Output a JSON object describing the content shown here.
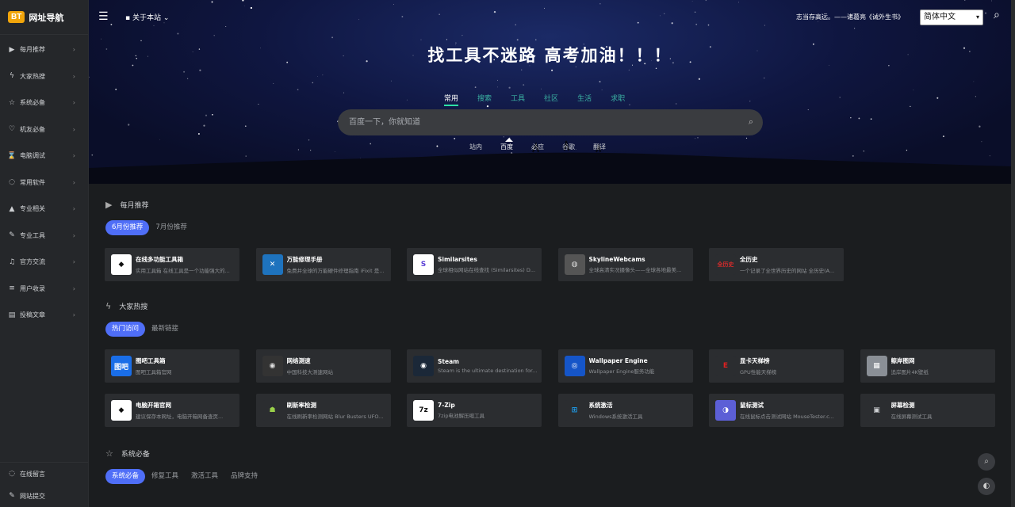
{
  "brand": {
    "logo": "BT",
    "name": "网址导航"
  },
  "sidebar": {
    "items": [
      {
        "icon": "video-icon",
        "glyph": "▶",
        "label": "每月推荐"
      },
      {
        "icon": "lightning-icon",
        "glyph": "ϟ",
        "label": "大家热搜"
      },
      {
        "icon": "star-icon",
        "glyph": "☆",
        "label": "系统必备"
      },
      {
        "icon": "thumb-icon",
        "glyph": "♡",
        "label": "机友必备"
      },
      {
        "icon": "hourglass-icon",
        "glyph": "⌛",
        "label": "电脑调试"
      },
      {
        "icon": "chat-icon",
        "glyph": "◌",
        "label": "常用软件"
      },
      {
        "icon": "graduation-icon",
        "glyph": "▲",
        "label": "专业相关"
      },
      {
        "icon": "wrench-icon",
        "glyph": "✎",
        "label": "专业工具"
      },
      {
        "icon": "bell-icon",
        "glyph": "♫",
        "label": "官方交流"
      },
      {
        "icon": "list-icon",
        "glyph": "≡",
        "label": "用户收录"
      },
      {
        "icon": "article-icon",
        "glyph": "▤",
        "label": "投稿文章"
      }
    ],
    "bottom": [
      {
        "icon": "message-icon",
        "glyph": "◌",
        "label": "在线留言"
      },
      {
        "icon": "pen-icon",
        "glyph": "✎",
        "label": "网站提交"
      }
    ]
  },
  "topbar": {
    "about": "关于本站",
    "quote": "志当存高远。——诸葛亮《诫外生书》",
    "language": "简体中文"
  },
  "hero": {
    "title": "找工具不迷路 高考加油！！！",
    "tabs": [
      "常用",
      "搜索",
      "工具",
      "社区",
      "生活",
      "求职"
    ],
    "search_placeholder": "百度一下，你就知道",
    "engines": [
      "站内",
      "百度",
      "必应",
      "谷歌",
      "翻译"
    ]
  },
  "sections": [
    {
      "title": "每月推荐",
      "icon": "video-icon",
      "glyph": "▶",
      "tabs": [
        "6月份推荐",
        "7月份推荐"
      ],
      "cards": [
        {
          "name": "在线多功能工具箱",
          "desc": "实用工具箱 在线工具是一个功能强大的...",
          "logo_text": "◆",
          "logo_bg": "#ffffff",
          "logo_fg": "#111111"
        },
        {
          "name": "万能修理手册",
          "desc": "免费并全球的万能硬件修理指南 iFixit 是...",
          "logo_text": "✕",
          "logo_bg": "#1e73be",
          "logo_fg": "#ffffff"
        },
        {
          "name": "Similarsites",
          "desc": "全球相似网站在线查找 (Similarsites) D...",
          "logo_text": "S",
          "logo_bg": "#ffffff",
          "logo_fg": "#5a3fd6"
        },
        {
          "name": "SkylineWebcams",
          "desc": "全球高清实况摄像头——全球各地最美...",
          "logo_text": "◍",
          "logo_bg": "#555555",
          "logo_fg": "#dddddd"
        },
        {
          "name": "全历史",
          "desc": "一个记录了全世界历史的网站 全历史(A...",
          "logo_text": "全历史",
          "logo_bg": "#2b2d30",
          "logo_fg": "#d62b2b"
        }
      ]
    },
    {
      "title": "大家热搜",
      "icon": "lightning-icon",
      "glyph": "ϟ",
      "tabs": [
        "热门访问",
        "最新链接"
      ],
      "cards": [
        {
          "name": "图吧工具箱",
          "desc": "图吧工具箱官网",
          "logo_text": "图吧",
          "logo_bg": "#1a6ee8",
          "logo_fg": "#ffffff"
        },
        {
          "name": "网络测速",
          "desc": "中国科技大测速网站",
          "logo_text": "◉",
          "logo_bg": "#333333",
          "logo_fg": "#e0e0e0"
        },
        {
          "name": "Steam",
          "desc": "Steam is the ultimate destination for...",
          "logo_text": "◉",
          "logo_bg": "#1b2838",
          "logo_fg": "#ffffff"
        },
        {
          "name": "Wallpaper Engine",
          "desc": "Wallpaper Engine服务功能",
          "logo_text": "◎",
          "logo_bg": "#1555c8",
          "logo_fg": "#ffffff"
        },
        {
          "name": "显卡天梯榜",
          "desc": "GPU性能天梯榜",
          "logo_text": "E",
          "logo_bg": "#2b2d30",
          "logo_fg": "#e02020"
        },
        {
          "name": "鲸岸图网",
          "desc": "追岸图片4K壁纸",
          "logo_text": "▦",
          "logo_bg": "#8a8f96",
          "logo_fg": "#ffffff"
        },
        {
          "name": "电脑开箱官网",
          "desc": "建议保存本网址，电脑开箱网备查页...",
          "logo_text": "◆",
          "logo_bg": "#ffffff",
          "logo_fg": "#111111"
        },
        {
          "name": "刷新率检测",
          "desc": "在线刷新率检测网站 Blur Busters UFO...",
          "logo_text": "☗",
          "logo_bg": "#2b2d30",
          "logo_fg": "#9ad14a"
        },
        {
          "name": "7-Zip",
          "desc": "7zip电池解压缩工具",
          "logo_text": "7z",
          "logo_bg": "#ffffff",
          "logo_fg": "#111111"
        },
        {
          "name": "系统激活",
          "desc": "Windows系统激活工具",
          "logo_text": "⊞",
          "logo_bg": "#2b2d30",
          "logo_fg": "#1da1f2"
        },
        {
          "name": "鼠标测试",
          "desc": "在线鼠标点击测试网站 MouseTester.c...",
          "logo_text": "◑",
          "logo_bg": "#5c5fd6",
          "logo_fg": "#ffffff"
        },
        {
          "name": "屏幕检测",
          "desc": "在线屏幕测试工具",
          "logo_text": "▣",
          "logo_bg": "#2b2d30",
          "logo_fg": "#cfd1d4"
        }
      ]
    },
    {
      "title": "系统必备",
      "icon": "star-icon",
      "glyph": "☆",
      "tabs": [
        "系统必备",
        "修复工具",
        "激活工具",
        "品牌支持"
      ],
      "cards": []
    }
  ]
}
